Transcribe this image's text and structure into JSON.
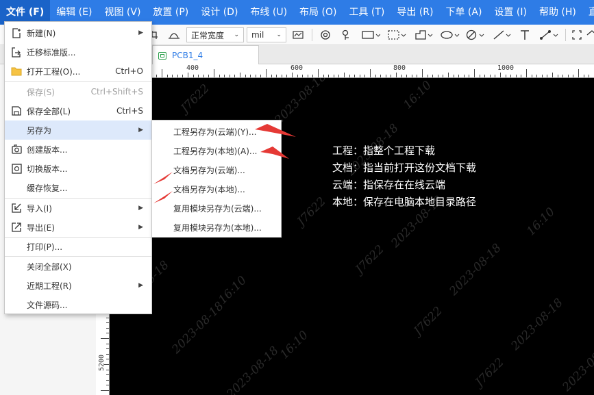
{
  "menubar": {
    "items": [
      "文件 (F)",
      "编辑 (E)",
      "视图 (V)",
      "放置 (P)",
      "设计 (D)",
      "布线 (U)",
      "布局 (O)",
      "工具 (T)",
      "导出 (R)",
      "下单 (A)",
      "设置 (I)",
      "帮助 (H)",
      "直"
    ]
  },
  "toolbar": {
    "line_width": "正常宽度",
    "unit": "mil"
  },
  "tabs": {
    "pcb_tab": "PCB1_4"
  },
  "ruler": {
    "top_labels": [
      "400",
      "600",
      "800",
      "1000"
    ],
    "left_label": "5200"
  },
  "file_menu": {
    "items": [
      {
        "label": "新建(N)",
        "shortcut": "",
        "submenu": true,
        "icon": "new-file-icon"
      },
      {
        "label": "迁移标准版...",
        "shortcut": "",
        "submenu": false,
        "icon": "migrate-icon"
      },
      {
        "label": "打开工程(O)...",
        "shortcut": "Ctrl+O",
        "submenu": false,
        "icon": "folder-icon"
      },
      {
        "label": "保存(S)",
        "shortcut": "Ctrl+Shift+S",
        "submenu": false,
        "icon": "",
        "disabled": true
      },
      {
        "label": "保存全部(L)",
        "shortcut": "Ctrl+S",
        "submenu": false,
        "icon": "save-icon"
      },
      {
        "label": "另存为",
        "shortcut": "",
        "submenu": true,
        "icon": "",
        "hover": true
      },
      {
        "label": "创建版本...",
        "shortcut": "",
        "submenu": false,
        "icon": "camera-icon"
      },
      {
        "label": "切换版本...",
        "shortcut": "",
        "submenu": false,
        "icon": "switch-version-icon"
      },
      {
        "label": "缓存恢复...",
        "shortcut": "",
        "submenu": false,
        "icon": ""
      },
      {
        "label": "导入(I)",
        "shortcut": "",
        "submenu": true,
        "icon": "import-icon"
      },
      {
        "label": "导出(E)",
        "shortcut": "",
        "submenu": true,
        "icon": "export-icon"
      },
      {
        "label": "打印(P)...",
        "shortcut": "",
        "submenu": false,
        "icon": ""
      },
      {
        "label": "关闭全部(X)",
        "shortcut": "",
        "submenu": false,
        "icon": ""
      },
      {
        "label": "近期工程(R)",
        "shortcut": "",
        "submenu": true,
        "icon": ""
      },
      {
        "label": "文件源码...",
        "shortcut": "",
        "submenu": false,
        "icon": ""
      }
    ]
  },
  "save_as_submenu": {
    "items": [
      "工程另存为(云端)(Y)...",
      "工程另存为(本地)(A)...",
      "文档另存为(云端)...",
      "文档另存为(本地)...",
      "复用模块另存为(云端)...",
      "复用模块另存为(本地)..."
    ]
  },
  "annotations": {
    "lines": [
      "工程：指整个工程下载",
      "文档：指当前打开这份文档下载",
      "云端：指保存在在线云端",
      "本地：保存在电脑本地目录路径"
    ],
    "arrow_color": "#e53935"
  },
  "watermark": {
    "texts": [
      "J7622",
      "2023-08-18",
      "16:10"
    ]
  },
  "colors": {
    "menubar": "#2e7ce6",
    "hover": "#dde9fb",
    "canvas": "#000000"
  }
}
